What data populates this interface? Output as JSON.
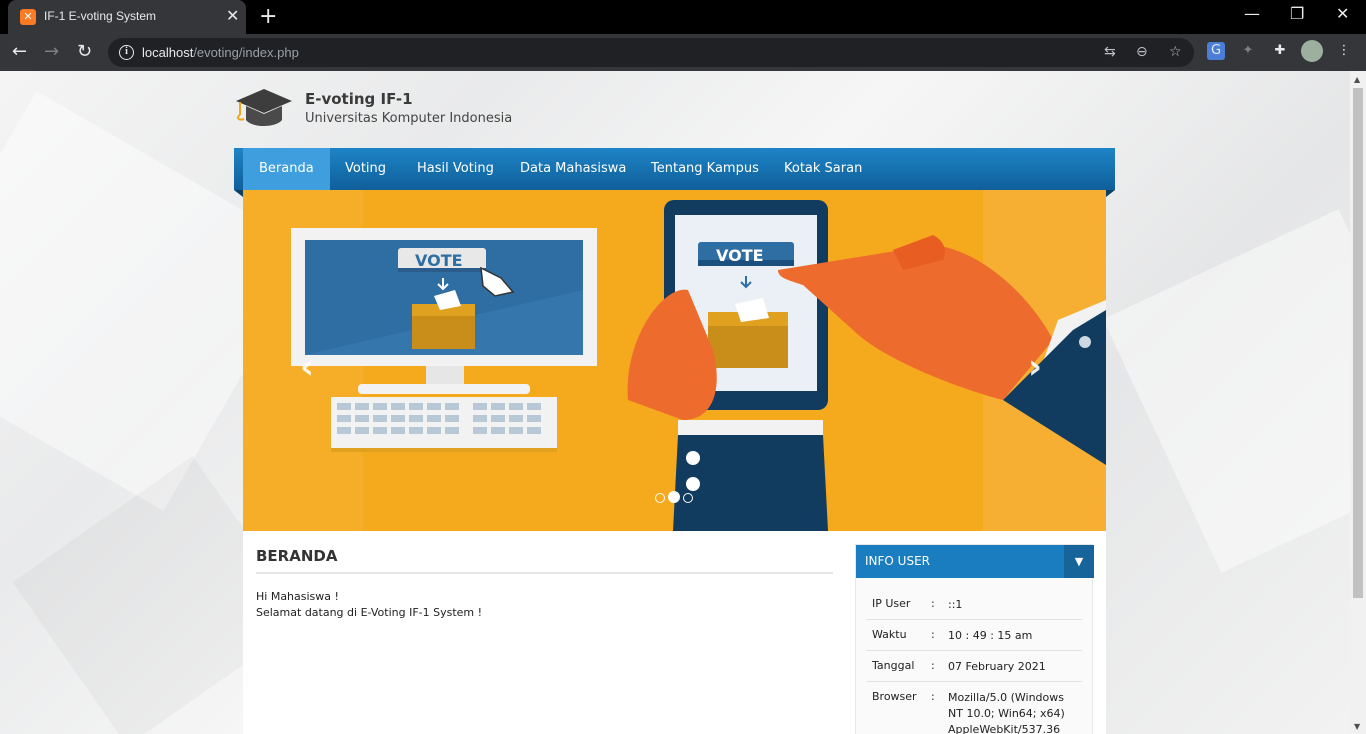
{
  "browser": {
    "tab_title": "IF-1 E-voting System",
    "tab_favicon": "xampp-icon",
    "url_host": "localhost",
    "url_path": "/evoting/index.php"
  },
  "header": {
    "title": "E-voting IF-1",
    "subtitle": "Universitas Komputer Indonesia"
  },
  "nav": {
    "items": [
      "Beranda",
      "Voting",
      "Hasil Voting",
      "Data Mahasiswa",
      "Tentang Kampus",
      "Kotak Saran"
    ],
    "active": "Beranda"
  },
  "slider": {
    "slide_text_1": "VOTE",
    "slide_text_2": "VOTE",
    "slides_count": 3,
    "active_slide": 2
  },
  "main": {
    "title": "BERANDA",
    "greeting": "Hi Mahasiswa !",
    "welcome": "Selamat datang di E-Voting IF-1 System !"
  },
  "info_user": {
    "title": "INFO USER",
    "rows": [
      {
        "label": "IP User",
        "sep": ":",
        "value": "::1"
      },
      {
        "label": "Waktu",
        "sep": ":",
        "value": "10 : 49 : 15 am"
      },
      {
        "label": "Tanggal",
        "sep": ":",
        "value": "07 February 2021"
      },
      {
        "label": "Browser",
        "sep": ":",
        "value": "Mozilla/5.0 (Windows NT 10.0; Win64; x64) AppleWebKit/537.36"
      }
    ]
  },
  "colors": {
    "nav_blue": "#1a7dc0",
    "nav_active": "#3f9ede",
    "slider_bg": "#f5a91c",
    "vote_blue": "#2f6ea3",
    "hand_orange": "#ee6b2e"
  }
}
